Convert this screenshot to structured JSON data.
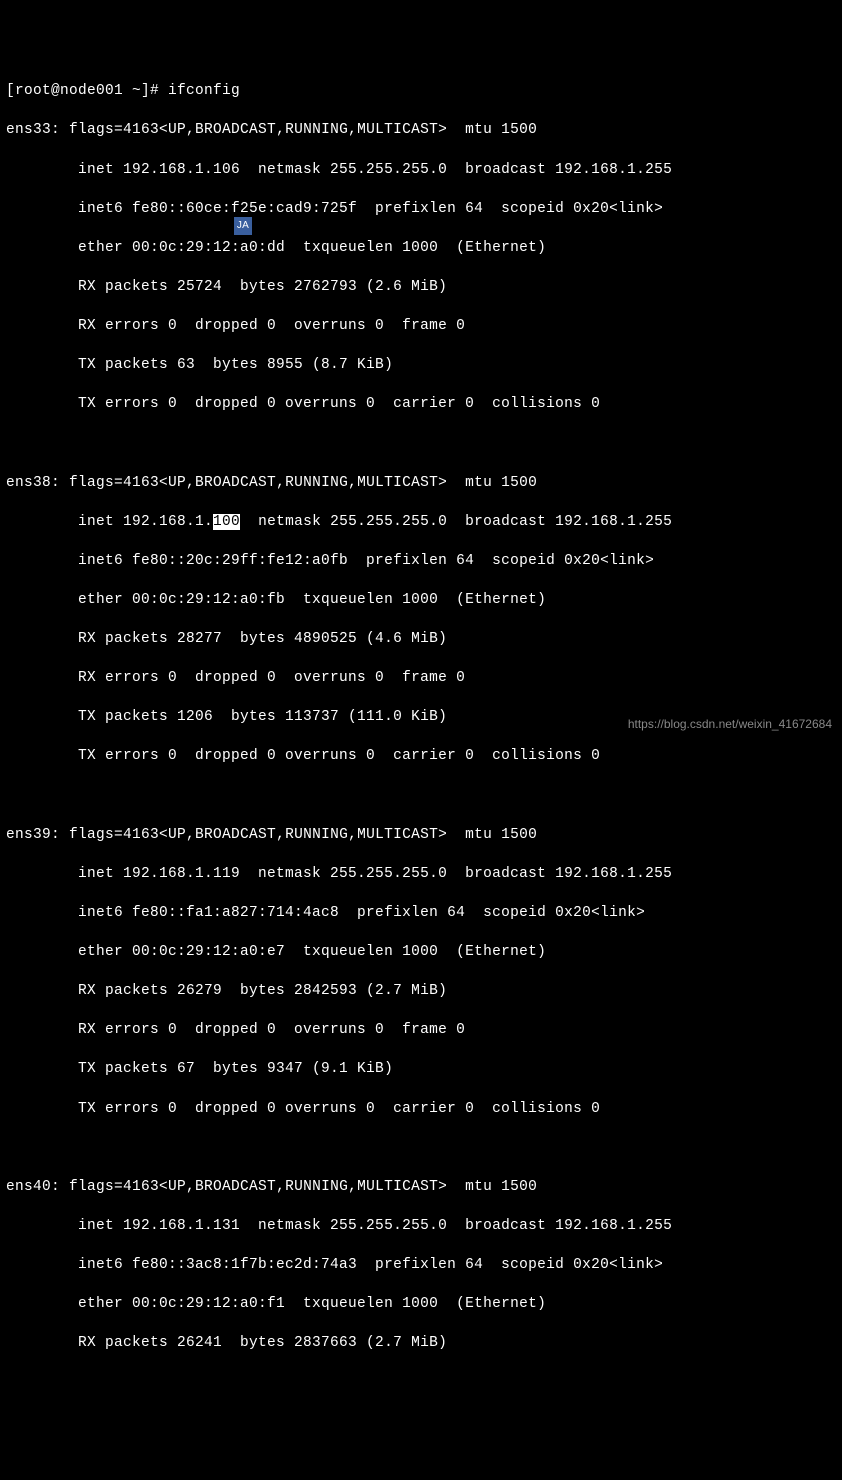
{
  "prompt": "[root@node001 ~]# ",
  "command": "ifconfig",
  "interfaces": [
    {
      "name": "ens33",
      "flags": "flags=4163<UP,BROADCAST,RUNNING,MULTICAST>  mtu 1500",
      "inet": "inet 192.168.1.106  netmask 255.255.255.0  broadcast 192.168.1.255",
      "inet6": "inet6 fe80::60ce:f25e:cad9:725f  prefixlen 64  scopeid 0x20<link>",
      "ether": "ether 00:0c:29:12:a0:dd  txqueuelen 1000  (Ethernet)",
      "rx_packets": "RX packets 25724  bytes 2762793 (2.6 MiB)",
      "rx_errors": "RX errors 0  dropped 0  overruns 0  frame 0",
      "tx_packets": "TX packets 63  bytes 8955 (8.7 KiB)",
      "tx_errors": "TX errors 0  dropped 0 overruns 0  carrier 0  collisions 0"
    },
    {
      "name": "ens38",
      "flags": "flags=4163<UP,BROADCAST,RUNNING,MULTICAST>  mtu 1500",
      "inet_pre": "inet 192.168.1.",
      "inet_hl": "100",
      "inet_post": "  netmask 255.255.255.0  broadcast 192.168.1.255",
      "inet6": "inet6 fe80::20c:29ff:fe12:a0fb  prefixlen 64  scopeid 0x20<link>",
      "ether": "ether 00:0c:29:12:a0:fb  txqueuelen 1000  (Ethernet)",
      "rx_packets": "RX packets 28277  bytes 4890525 (4.6 MiB)",
      "rx_errors": "RX errors 0  dropped 0  overruns 0  frame 0",
      "tx_packets": "TX packets 1206  bytes 113737 (111.0 KiB)",
      "tx_errors": "TX errors 0  dropped 0 overruns 0  carrier 0  collisions 0"
    },
    {
      "name": "ens39",
      "flags": "flags=4163<UP,BROADCAST,RUNNING,MULTICAST>  mtu 1500",
      "inet": "inet 192.168.1.119  netmask 255.255.255.0  broadcast 192.168.1.255",
      "inet6": "inet6 fe80::fa1:a827:714:4ac8  prefixlen 64  scopeid 0x20<link>",
      "ether": "ether 00:0c:29:12:a0:e7  txqueuelen 1000  (Ethernet)",
      "rx_packets": "RX packets 26279  bytes 2842593 (2.7 MiB)",
      "rx_errors": "RX errors 0  dropped 0  overruns 0  frame 0",
      "tx_packets": "TX packets 67  bytes 9347 (9.1 KiB)",
      "tx_errors": "TX errors 0  dropped 0 overruns 0  carrier 0  collisions 0"
    },
    {
      "name": "ens40",
      "flags": "flags=4163<UP,BROADCAST,RUNNING,MULTICAST>  mtu 1500",
      "inet": "inet 192.168.1.131  netmask 255.255.255.0  broadcast 192.168.1.255",
      "inet6": "inet6 fe80::3ac8:1f7b:ec2d:74a3  prefixlen 64  scopeid 0x20<link>",
      "ether": "ether 00:0c:29:12:a0:f1  txqueuelen 1000  (Ethernet)",
      "rx_packets": "RX packets 26241  bytes 2837663 (2.7 MiB)"
    }
  ],
  "watermark": "https://blog.csdn.net/weixin_41672684",
  "ime_label": "JA"
}
